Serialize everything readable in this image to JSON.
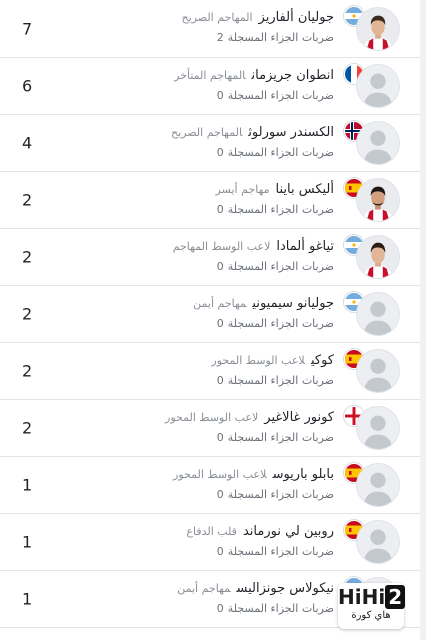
{
  "players": [
    {
      "name": "جوليان ألفاريز",
      "position": "المهاجم الصريح",
      "stat_label": "ضربات الجزاء المسجلة",
      "stat_value": "2",
      "goals": "7",
      "flag": "argentina",
      "avatar": "photo-red"
    },
    {
      "name": "انطوان جريزمان",
      "position": "المهاجم المتأخر",
      "stat_label": "ضربات الجزاء المسجلة",
      "stat_value": "0",
      "goals": "6",
      "flag": "france",
      "avatar": "placeholder"
    },
    {
      "name": "الكسندر سورلوث",
      "position": "المهاجم الصريح",
      "stat_label": "ضربات الجزاء المسجلة",
      "stat_value": "0",
      "goals": "4",
      "flag": "norway",
      "avatar": "placeholder"
    },
    {
      "name": "أليكس باينا",
      "position": "مهاجم أيسر",
      "stat_label": "ضربات الجزاء المسجلة",
      "stat_value": "0",
      "goals": "2",
      "flag": "spain",
      "avatar": "photo-red"
    },
    {
      "name": "تياغو ألمادا",
      "position": "لاعب الوسط المهاجم",
      "stat_label": "ضربات الجزاء المسجلة",
      "stat_value": "0",
      "goals": "2",
      "flag": "argentina",
      "avatar": "photo-red"
    },
    {
      "name": "جوليانو سيميوني",
      "position": "مهاجم أيمن",
      "stat_label": "ضربات الجزاء المسجلة",
      "stat_value": "0",
      "goals": "2",
      "flag": "argentina",
      "avatar": "placeholder"
    },
    {
      "name": "كوكي",
      "position": "لاعب الوسط المحور",
      "stat_label": "ضربات الجزاء المسجلة",
      "stat_value": "0",
      "goals": "2",
      "flag": "spain",
      "avatar": "placeholder"
    },
    {
      "name": "كونور غالاغير",
      "position": "لاعب الوسط المحور",
      "stat_label": "ضربات الجزاء المسجلة",
      "stat_value": "0",
      "goals": "2",
      "flag": "england",
      "avatar": "placeholder"
    },
    {
      "name": "بابلو باريوس",
      "position": "لاعب الوسط المحور",
      "stat_label": "ضربات الجزاء المسجلة",
      "stat_value": "0",
      "goals": "1",
      "flag": "spain",
      "avatar": "placeholder"
    },
    {
      "name": "روبين لي نورماند",
      "position": "قلب الدفاع",
      "stat_label": "ضربات الجزاء المسجلة",
      "stat_value": "0",
      "goals": "1",
      "flag": "spain",
      "avatar": "placeholder"
    },
    {
      "name": "نيكولاس جونزاليس",
      "position": "مهاجم أيمن",
      "stat_label": "ضربات الجزاء المسجلة",
      "stat_value": "0",
      "goals": "1",
      "flag": "argentina",
      "avatar": "placeholder"
    }
  ],
  "watermark": {
    "logo_text_a": "HiHi",
    "logo_text_b": "2",
    "subtitle": "هاي كورة"
  },
  "colors": {
    "argentina_blue": "#74acdf",
    "spain_red": "#c60b1e",
    "spain_yellow": "#ffc400",
    "france_blue": "#0055a4",
    "france_red": "#ef4135",
    "norway_red": "#ba0c2f",
    "norway_blue": "#00205b",
    "england_red": "#ce1124",
    "kit_red": "#c8102e"
  }
}
